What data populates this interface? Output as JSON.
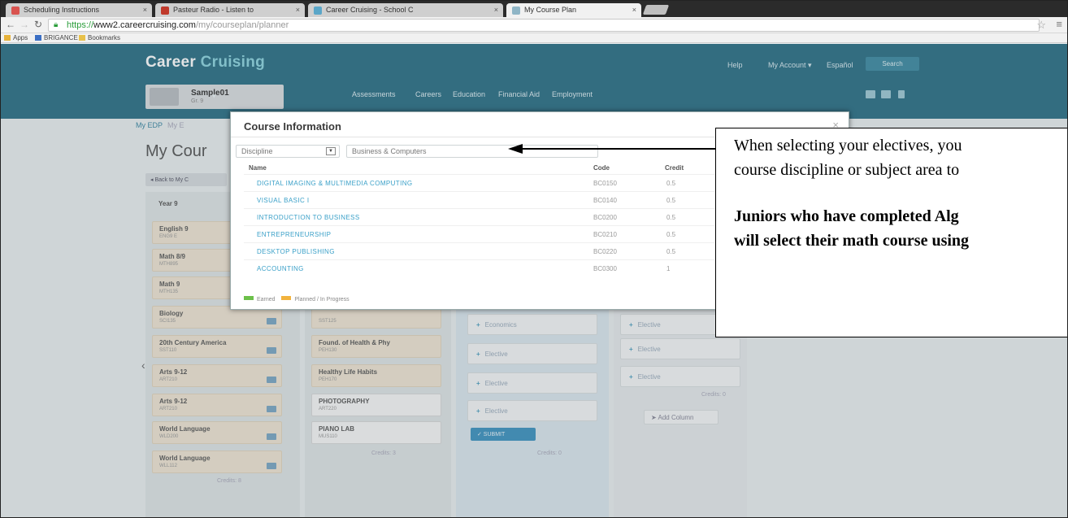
{
  "browser": {
    "tabs": [
      {
        "label": "Scheduling Instructions",
        "favicon_color": "#d9534f"
      },
      {
        "label": "Pasteur Radio - Listen to",
        "favicon_color": "#c0392b"
      },
      {
        "label": "Career Cruising - School C",
        "favicon_color": "#5aa6c8"
      },
      {
        "label": "My Course Plan",
        "favicon_color": "#8fb5c6"
      }
    ],
    "url_https": "https://",
    "url_host": "www2.careercruising.com",
    "url_path": "/my/courseplan/planner",
    "bookmarks": [
      "Apps",
      "BRIGANCE",
      "Bookmarks"
    ]
  },
  "site": {
    "brand_part1": "Career",
    "brand_part2": "Cruising",
    "top_links": [
      "Español",
      "Help",
      "My Account ▾"
    ],
    "search_label": "Search",
    "profile_name": "Sample01",
    "profile_sub": "Gr. 9",
    "main_nav": [
      "Assessments",
      "Careers",
      "Education",
      "Financial Aid",
      "Employment"
    ],
    "subnav_active": "My EDP",
    "subnav_other": "My E",
    "page_title": "My Cour",
    "back_label": "◂ Back to My C"
  },
  "plan": {
    "year_label": "Year 9",
    "col1_cards": [
      {
        "name": "English 9",
        "code": "ENG9 E"
      },
      {
        "name": "Math 8/9",
        "code": "MTH895"
      },
      {
        "name": "Math 9",
        "code": "MTH135"
      },
      {
        "name": "Biology",
        "code": "SCI135"
      },
      {
        "name": "20th Century America",
        "code": "SST110"
      },
      {
        "name": "Arts 9-12",
        "code": "ART210"
      },
      {
        "name": "Arts 9-12",
        "code": "ART210"
      },
      {
        "name": "World Language",
        "code": "WLD200"
      },
      {
        "name": "World Language",
        "code": "WLL112"
      }
    ],
    "col2_cards": [
      {
        "name": "Found. of Health & Phy",
        "code": "PEH130"
      },
      {
        "name": "Healthy Life Habits",
        "code": "PEH170"
      },
      {
        "name": "PHOTOGRAPHY",
        "code": "ART220"
      },
      {
        "name": "PIANO LAB",
        "code": "MUS110"
      }
    ],
    "col2_top_code": "SST125",
    "col3_items": [
      "Economics",
      "Elective",
      "Elective",
      "Elective"
    ],
    "col4_items": [
      "Elective",
      "Elective",
      "Elective"
    ],
    "col1_credits": "Credits: 8",
    "col2_credits": "Credits: 3",
    "col3_credits": "Credits: 0",
    "col4_credits": "Credits: 0",
    "submit_label": "✓ SUBMIT",
    "add_column_label": "➤ Add Column"
  },
  "modal": {
    "title": "Course Information",
    "close": "×",
    "filter_type": "Discipline",
    "filter_value": "Business & Computers",
    "col_name": "Name",
    "col_code": "Code",
    "col_credit": "Credit",
    "courses": [
      {
        "name": "DIGITAL IMAGING & MULTIMEDIA COMPUTING",
        "code": "BC0150",
        "credit": "0.5"
      },
      {
        "name": "VISUAL BASIC I",
        "code": "BC0140",
        "credit": "0.5"
      },
      {
        "name": "INTRODUCTION TO BUSINESS",
        "code": "BC0200",
        "credit": "0.5"
      },
      {
        "name": "ENTREPRENEURSHIP",
        "code": "BC0210",
        "credit": "0.5"
      },
      {
        "name": "DESKTOP PUBLISHING",
        "code": "BC0220",
        "credit": "0.5"
      },
      {
        "name": "ACCOUNTING",
        "code": "BC0300",
        "credit": "1"
      }
    ],
    "legend_earned": "Earned",
    "legend_planned": "Planned / In Progress",
    "colors": {
      "earned": "#6cc04a",
      "planned": "#f2b33d",
      "link": "#3aa0c8"
    }
  },
  "annotation": {
    "line1": "When selecting your electives, you",
    "line2": "course discipline or subject area to",
    "line3": "Juniors who have completed Alg",
    "line4": "will select their math course using"
  },
  "colors": {
    "header": "#2b6f86",
    "accent": "#3e93c0"
  }
}
